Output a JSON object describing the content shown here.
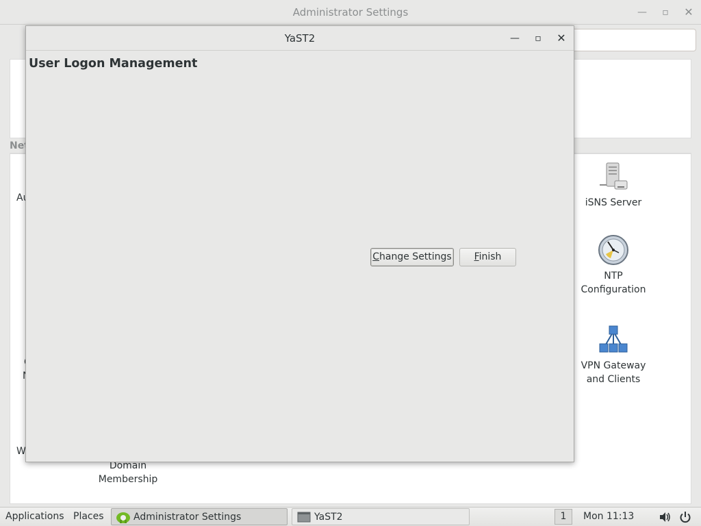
{
  "background_window": {
    "title": "Administrator Settings",
    "section_label": "Net",
    "edge_text_left_1": "Au",
    "edge_text_left_2": "C",
    "edge_text_left_3": "N",
    "edge_text_left_4": "W",
    "modules": [
      {
        "label": "iSNS Server",
        "icon": "server-icon"
      },
      {
        "label": "NTP Configuration",
        "icon": "clock-icon"
      },
      {
        "label": "VPN Gateway and Clients",
        "icon": "network-icon"
      },
      {
        "label": "Domain Membership",
        "icon": "domain-icon"
      }
    ]
  },
  "dialog": {
    "title": "YaST2",
    "heading": "User Logon Management",
    "buttons": {
      "change_settings": {
        "mnemonic": "C",
        "rest": "hange Settings"
      },
      "finish": {
        "mnemonic": "F",
        "rest": "inish"
      }
    }
  },
  "taskbar": {
    "applications": "Applications",
    "places": "Places",
    "tasks": [
      {
        "label": "Administrator Settings",
        "icon": "yast-icon"
      },
      {
        "label": "YaST2",
        "icon": "window-icon"
      }
    ],
    "workspace": "1",
    "clock": "Mon 11:13",
    "volume_icon": "volume-icon",
    "power_icon": "power-icon"
  },
  "colors": {
    "window_bg": "#e8e8e7",
    "text": "#2e3436",
    "inactive_text": "#8b8e8f",
    "accent_blue": "#4a86cf"
  }
}
